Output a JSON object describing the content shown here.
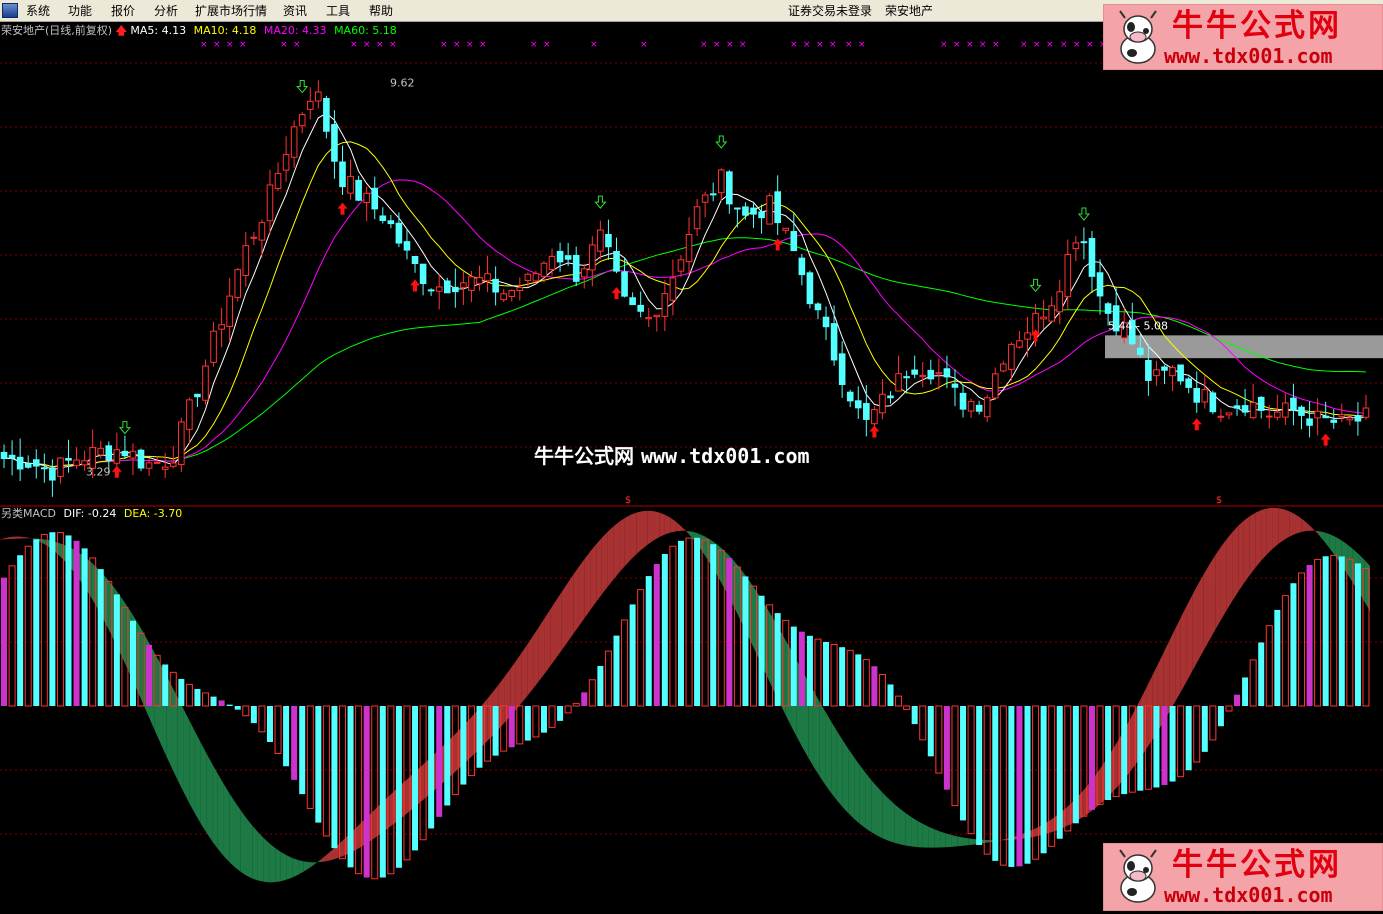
{
  "menu": {
    "items": [
      "系统",
      "功能",
      "报价",
      "分析",
      "扩展市场行情",
      "资讯",
      "工具",
      "帮助"
    ],
    "status": "证券交易未登录",
    "stock_name": "荣安地产"
  },
  "legend": {
    "title": "荣安地产(日线,前复权)",
    "ma5": "MA5: 4.13",
    "ma10": "MA10: 4.18",
    "ma20": "MA20: 4.33",
    "ma60": "MA60: 5.18",
    "macd_name": "另类MACD",
    "dif": "DIF: -0.24",
    "dea": "DEA: -3.70"
  },
  "annotations": {
    "high_label": "9.62",
    "low_label": "3.29",
    "zone_label": "5.44 - 5.08"
  },
  "watermark": {
    "brand": "牛牛公式网",
    "url": "www.tdx001.com",
    "center_brand": "牛牛公式网",
    "center_url": "www.tdx001.com"
  },
  "colors": {
    "background": "#000000",
    "up": "#ff3232",
    "down": "#54ffff",
    "ma5": "#ffffff",
    "ma10": "#ffff00",
    "ma20": "#ff00ff",
    "ma60": "#00ff00",
    "band_bull": "#a83232",
    "band_bear": "#1d7a45",
    "grid": "#800000"
  },
  "icons": {
    "buy_signal": "red-up-arrow-icon",
    "sell_signal": "green-down-arrow-icon",
    "cross_marker": "magenta-x-icon",
    "dollar_marker": "red-dollar-icon"
  },
  "chart_data": {
    "type": "candlestick",
    "title": "荣安地产(日线,前复权)",
    "price_range": [
      3.0,
      10.1
    ],
    "period_high": 9.62,
    "period_low": 3.29,
    "close_anchors": [
      3.5,
      3.45,
      3.3,
      3.5,
      3.6,
      3.65,
      3.4,
      3.5,
      4.5,
      5.6,
      6.7,
      7.5,
      8.6,
      9.4,
      8.0,
      7.6,
      7.3,
      6.6,
      6.2,
      6.3,
      6.3,
      6.1,
      6.3,
      6.8,
      6.4,
      7.0,
      5.9,
      5.7,
      6.4,
      7.4,
      7.9,
      7.3,
      7.5,
      6.8,
      5.8,
      4.9,
      4.0,
      4.5,
      5.0,
      4.9,
      4.4,
      4.4,
      5.3,
      5.6,
      6.1,
      7.2,
      5.9,
      5.5,
      4.7,
      4.9,
      4.5,
      4.3,
      4.4,
      4.2,
      4.25,
      4.1,
      4.05,
      4.13
    ],
    "ma5_last": 4.13,
    "ma10_last": 4.18,
    "ma20_last": 4.33,
    "ma60_last": 5.18,
    "zone": [
      5.08,
      5.44
    ],
    "macd": {
      "name": "另类MACD",
      "dif_last": -0.24,
      "dea_last": -3.7,
      "range": [
        -10,
        10
      ]
    }
  }
}
